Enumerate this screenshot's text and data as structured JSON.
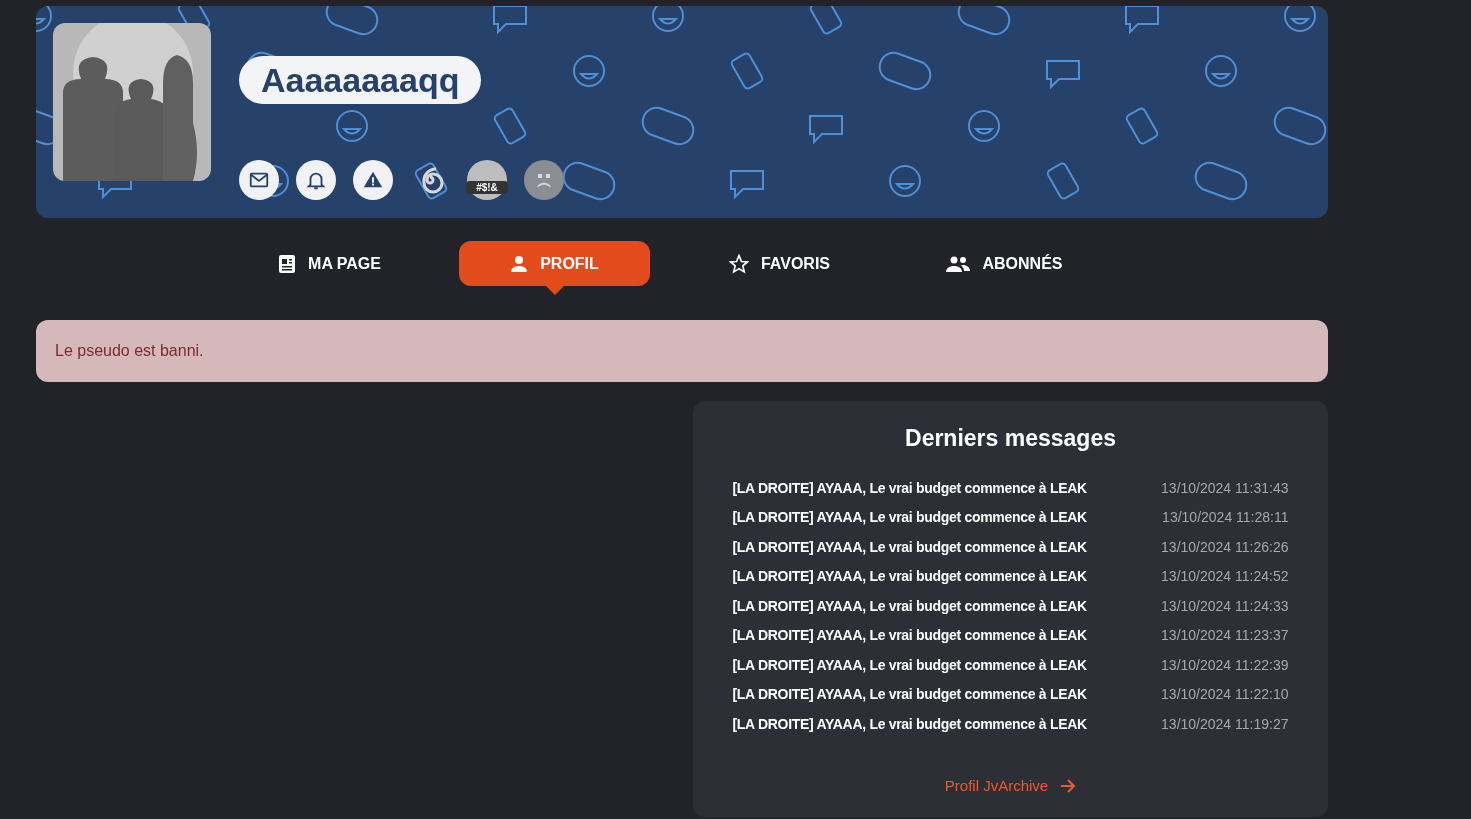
{
  "profile": {
    "username": "Aaaaaaaaqq",
    "badges": [
      {
        "kind": "mail"
      },
      {
        "kind": "bell"
      },
      {
        "kind": "warning"
      },
      {
        "kind": "spiral"
      },
      {
        "kind": "swearing",
        "text": "#$!&"
      },
      {
        "kind": "sad"
      }
    ]
  },
  "tabs": [
    {
      "kind": "page",
      "label": "MA PAGE",
      "selected": false
    },
    {
      "kind": "profile",
      "label": "PROFIL",
      "selected": true
    },
    {
      "kind": "favorites",
      "label": "FAVORIS",
      "selected": false
    },
    {
      "kind": "followers",
      "label": "ABONNÉS",
      "selected": false
    }
  ],
  "alert": "Le pseudo est banni.",
  "messages_card": {
    "title": "Derniers messages",
    "messages": [
      {
        "subject": "[LA DROITE] AYAAA, Le vrai budget commence à LEAK",
        "date": "13/10/2024 11:31:43"
      },
      {
        "subject": "[LA DROITE] AYAAA, Le vrai budget commence à LEAK",
        "date": "13/10/2024 11:28:11"
      },
      {
        "subject": "[LA DROITE] AYAAA, Le vrai budget commence à LEAK",
        "date": "13/10/2024 11:26:26"
      },
      {
        "subject": "[LA DROITE] AYAAA, Le vrai budget commence à LEAK",
        "date": "13/10/2024 11:24:52"
      },
      {
        "subject": "[LA DROITE] AYAAA, Le vrai budget commence à LEAK",
        "date": "13/10/2024 11:24:33"
      },
      {
        "subject": "[LA DROITE] AYAAA, Le vrai budget commence à LEAK",
        "date": "13/10/2024 11:23:37"
      },
      {
        "subject": "[LA DROITE] AYAAA, Le vrai budget commence à LEAK",
        "date": "13/10/2024 11:22:39"
      },
      {
        "subject": "[LA DROITE] AYAAA, Le vrai budget commence à LEAK",
        "date": "13/10/2024 11:22:10"
      },
      {
        "subject": "[LA DROITE] AYAAA, Le vrai budget commence à LEAK",
        "date": "13/10/2024 11:19:27"
      }
    ],
    "link": "Profil JvArchive"
  }
}
